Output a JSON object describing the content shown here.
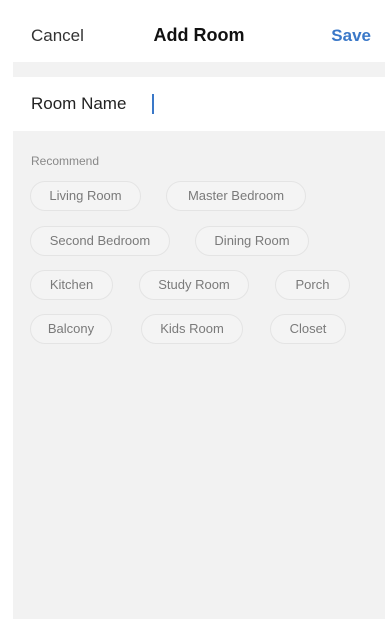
{
  "header": {
    "cancel_label": "Cancel",
    "title": "Add Room",
    "save_label": "Save"
  },
  "room_name": {
    "label": "Room Name",
    "value": ""
  },
  "recommend": {
    "label": "Recommend",
    "rooms": [
      "Living Room",
      "Master Bedroom",
      "Second Bedroom",
      "Dining Room",
      "Kitchen",
      "Study Room",
      "Porch",
      "Balcony",
      "Kids Room",
      "Closet"
    ]
  }
}
